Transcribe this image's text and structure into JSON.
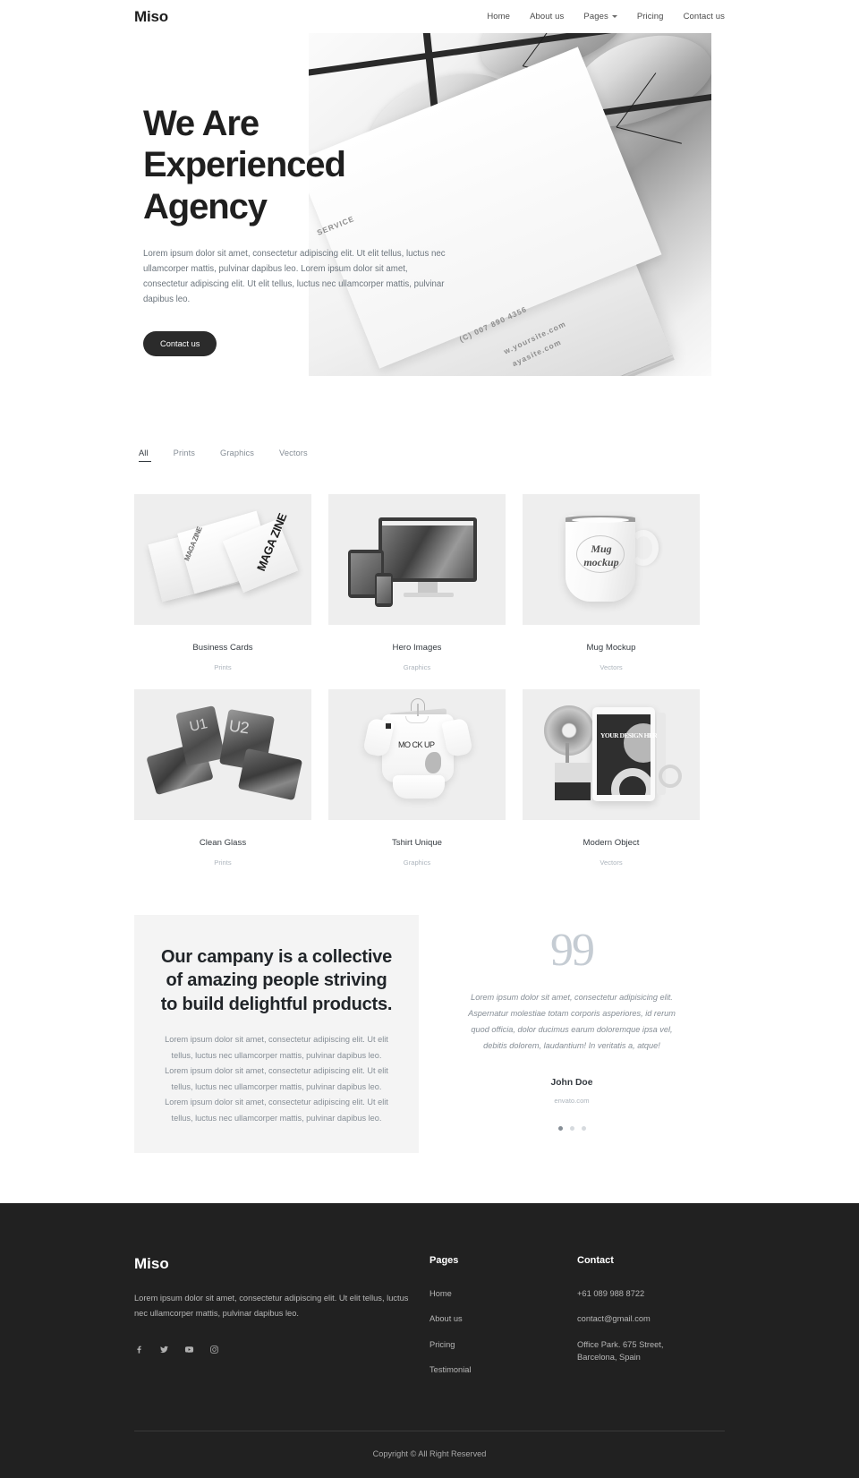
{
  "header": {
    "brand": "Miso",
    "nav": [
      {
        "label": "Home",
        "caret": false
      },
      {
        "label": "About us",
        "caret": false
      },
      {
        "label": "Pages",
        "caret": true
      },
      {
        "label": "Pricing",
        "caret": false
      },
      {
        "label": "Contact us",
        "caret": false
      }
    ]
  },
  "hero": {
    "title": "We Are\nExperienced\nAgency",
    "subtitle": "Lorem ipsum dolor sit amet, consectetur adipiscing elit. Ut elit tellus, luctus nec ullamcorper mattis, pulvinar dapibus leo. Lorem ipsum dolor sit amet, consectetur adipiscing elit. Ut elit tellus, luctus nec ullamcorper mattis, pulvinar dapibus leo.",
    "cta": "Contact us",
    "photo_overlay_text": {
      "service": "SERVICE",
      "phone": "(C) 007 890 4356",
      "site1": "w.yoursite.com",
      "site2": "ayasite.com"
    }
  },
  "portfolio": {
    "filters": [
      {
        "label": "All",
        "active": true
      },
      {
        "label": "Prints",
        "active": false
      },
      {
        "label": "Graphics",
        "active": false
      },
      {
        "label": "Vectors",
        "active": false
      }
    ],
    "items": [
      {
        "title": "Business Cards",
        "category": "Prints",
        "art": "magazine"
      },
      {
        "title": "Hero Images",
        "category": "Graphics",
        "art": "devices"
      },
      {
        "title": "Mug Mockup",
        "category": "Vectors",
        "art": "mug"
      },
      {
        "title": "Clean Glass",
        "category": "Prints",
        "art": "foldphone"
      },
      {
        "title": "Tshirt Unique",
        "category": "Graphics",
        "art": "tshirt"
      },
      {
        "title": "Modern Object",
        "category": "Vectors",
        "art": "stationery"
      }
    ],
    "art_labels": {
      "magazine": "MAGA ZINE",
      "tshirt": "MO CK UP",
      "stationery": "YOUR DESIGN HERE",
      "foldphone_left": "U1",
      "foldphone_right": "U2",
      "mug": "Mug mockup"
    }
  },
  "about": {
    "title": "Our campany is a collective of amazing people striving to build delightful products.",
    "text": "Lorem ipsum dolor sit amet, consectetur adipiscing elit. Ut elit tellus, luctus nec ullamcorper mattis, pulvinar dapibus leo. Lorem ipsum dolor sit amet, consectetur adipiscing elit. Ut elit tellus, luctus nec ullamcorper mattis, pulvinar dapibus leo. Lorem ipsum dolor sit amet, consectetur adipiscing elit. Ut elit tellus, luctus nec ullamcorper mattis, pulvinar dapibus leo."
  },
  "testimonial": {
    "quote_mark": "99",
    "text": "Lorem ipsum dolor sit amet, consectetur adipisicing elit. Aspernatur molestiae totam corporis asperiores, id rerum quod officia, dolor ducimus earum doloremque ipsa vel, debitis dolorem, laudantium! In veritatis a, atque!",
    "name": "John Doe",
    "role": "envato.com",
    "slides": 3,
    "active_slide": 0
  },
  "footer": {
    "brand": "Miso",
    "description": "Lorem ipsum dolor sit amet, consectetur adipiscing elit. Ut elit tellus, luctus nec ullamcorper mattis, pulvinar dapibus leo.",
    "socials": [
      "facebook-icon",
      "twitter-icon",
      "youtube-icon",
      "instagram-icon"
    ],
    "pages": {
      "heading": "Pages",
      "items": [
        "Home",
        "About us",
        "Pricing",
        "Testimonial"
      ]
    },
    "contact": {
      "heading": "Contact",
      "items": [
        "+61 089 988 8722",
        "contact@gmail.com",
        "Office Park. 675 Street, Barcelona, Spain"
      ]
    },
    "copyright": "Copyright © All Right Reserved"
  },
  "colors": {
    "dark": "#212121",
    "text": "#212529",
    "muted": "#868e96",
    "thumb_bg": "#eeeeee",
    "about_bg": "#f4f4f4"
  }
}
